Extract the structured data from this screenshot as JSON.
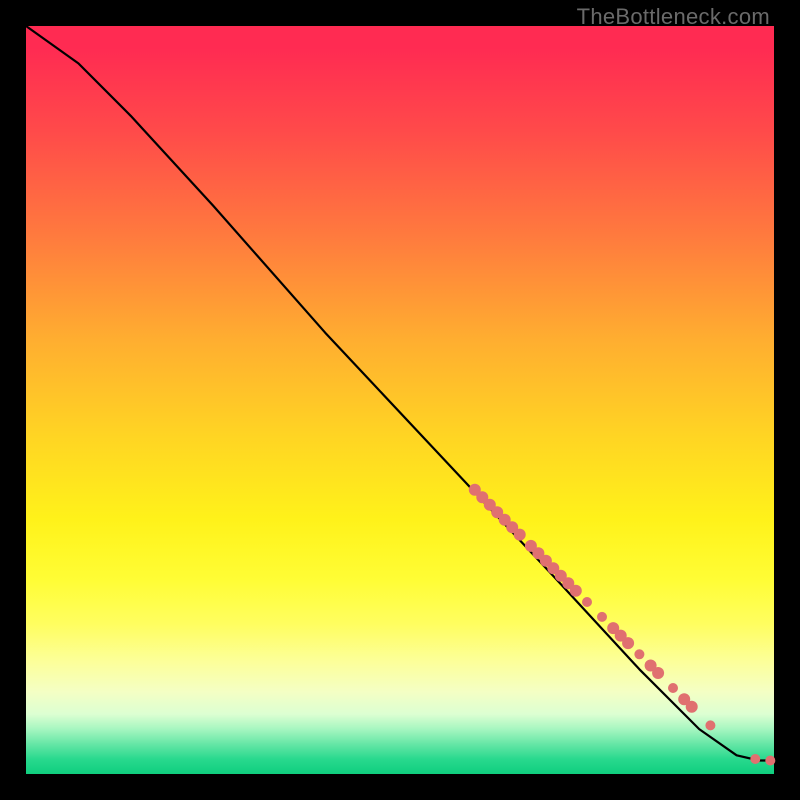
{
  "watermark": "TheBottleneck.com",
  "colors": {
    "marker": "#e07070",
    "curve": "#000000",
    "frame": "#000000"
  },
  "chart_data": {
    "type": "line",
    "title": "",
    "xlabel": "",
    "ylabel": "",
    "xlim": [
      0,
      100
    ],
    "ylim": [
      0,
      100
    ],
    "grid": false,
    "legend": false,
    "series": [
      {
        "name": "curve",
        "points": [
          {
            "x": 0,
            "y": 100
          },
          {
            "x": 7,
            "y": 95
          },
          {
            "x": 14,
            "y": 88
          },
          {
            "x": 25,
            "y": 76
          },
          {
            "x": 40,
            "y": 59
          },
          {
            "x": 55,
            "y": 43
          },
          {
            "x": 70,
            "y": 27
          },
          {
            "x": 82,
            "y": 14
          },
          {
            "x": 90,
            "y": 6
          },
          {
            "x": 95,
            "y": 2.5
          },
          {
            "x": 98,
            "y": 1.8
          },
          {
            "x": 100,
            "y": 1.8
          }
        ]
      }
    ],
    "markers": {
      "name": "highlighted-points",
      "color": "#e07070",
      "points": [
        {
          "x": 60,
          "y": 38,
          "r": 6
        },
        {
          "x": 61,
          "y": 37,
          "r": 6
        },
        {
          "x": 62,
          "y": 36,
          "r": 6
        },
        {
          "x": 63,
          "y": 35,
          "r": 6
        },
        {
          "x": 64,
          "y": 34,
          "r": 6
        },
        {
          "x": 65,
          "y": 33,
          "r": 6
        },
        {
          "x": 66,
          "y": 32,
          "r": 6
        },
        {
          "x": 67.5,
          "y": 30.5,
          "r": 6
        },
        {
          "x": 68.5,
          "y": 29.5,
          "r": 6
        },
        {
          "x": 69.5,
          "y": 28.5,
          "r": 6
        },
        {
          "x": 70.5,
          "y": 27.5,
          "r": 6
        },
        {
          "x": 71.5,
          "y": 26.5,
          "r": 6
        },
        {
          "x": 72.5,
          "y": 25.5,
          "r": 6
        },
        {
          "x": 73.5,
          "y": 24.5,
          "r": 6
        },
        {
          "x": 75,
          "y": 23,
          "r": 5
        },
        {
          "x": 77,
          "y": 21,
          "r": 5
        },
        {
          "x": 78.5,
          "y": 19.5,
          "r": 6
        },
        {
          "x": 79.5,
          "y": 18.5,
          "r": 6
        },
        {
          "x": 80.5,
          "y": 17.5,
          "r": 6
        },
        {
          "x": 82,
          "y": 16,
          "r": 5
        },
        {
          "x": 83.5,
          "y": 14.5,
          "r": 6
        },
        {
          "x": 84.5,
          "y": 13.5,
          "r": 6
        },
        {
          "x": 86.5,
          "y": 11.5,
          "r": 5
        },
        {
          "x": 88,
          "y": 10,
          "r": 6
        },
        {
          "x": 89,
          "y": 9,
          "r": 6
        },
        {
          "x": 91.5,
          "y": 6.5,
          "r": 5
        },
        {
          "x": 97.5,
          "y": 2,
          "r": 5
        },
        {
          "x": 99.5,
          "y": 1.8,
          "r": 5
        }
      ]
    }
  }
}
